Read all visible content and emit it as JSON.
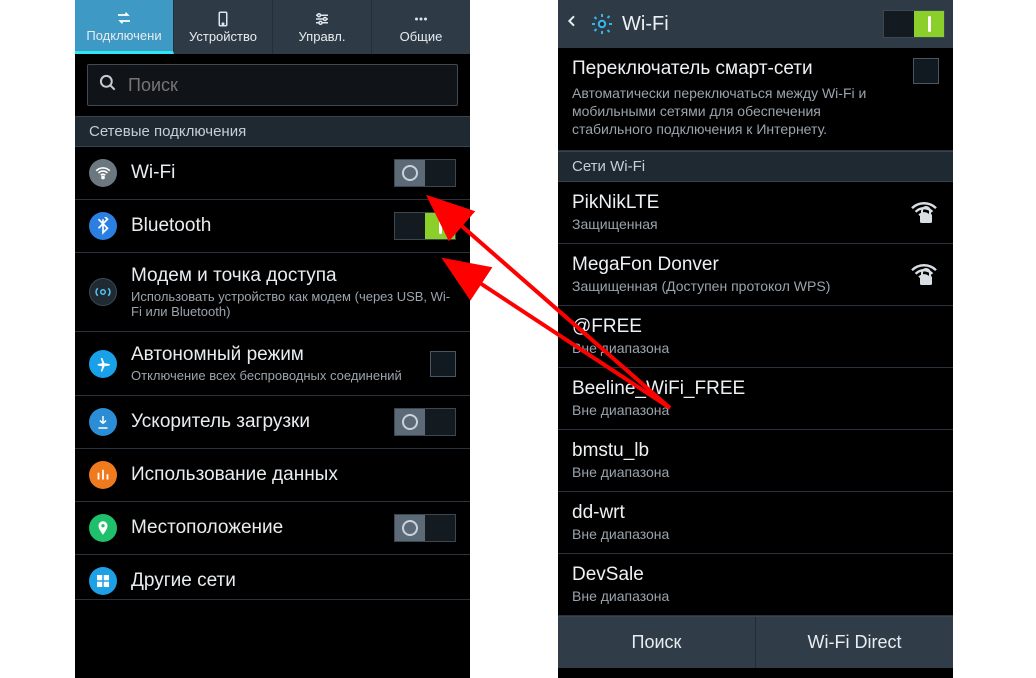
{
  "leftPhone": {
    "tabs": [
      {
        "label": "Подключени",
        "icon": "swap-icon",
        "active": true
      },
      {
        "label": "Устройство",
        "icon": "device-icon",
        "active": false
      },
      {
        "label": "Управл.",
        "icon": "sliders-icon",
        "active": false
      },
      {
        "label": "Общие",
        "icon": "more-icon",
        "active": false
      }
    ],
    "searchPlaceholder": "Поиск",
    "sectionHeader": "Сетевые подключения",
    "rows": {
      "wifi": {
        "title": "Wi-Fi"
      },
      "bluetooth": {
        "title": "Bluetooth"
      },
      "tethering": {
        "title": "Модем и точка доступа",
        "sub": "Использовать устройство как модем (через USB, Wi-Fi или Bluetooth)"
      },
      "airplane": {
        "title": "Автономный режим",
        "sub": "Отключение всех беспроводных соединений"
      },
      "booster": {
        "title": "Ускоритель загрузки"
      },
      "datausage": {
        "title": "Использование данных"
      },
      "location": {
        "title": "Местоположение"
      },
      "othernets": {
        "title": "Другие сети"
      }
    }
  },
  "rightPhone": {
    "title": "Wi-Fi",
    "smartNet": {
      "title": "Переключатель смарт-сети",
      "sub": "Автоматически переключаться между Wi-Fi и мобильными сетями для обеспечения стабильного подключения к Интернету."
    },
    "listHeader": "Сети Wi-Fi",
    "networks": [
      {
        "name": "PikNikLTE",
        "sub": "Защищенная",
        "signal": true,
        "locked": true
      },
      {
        "name": "MegaFon Donver",
        "sub": "Защищенная (Доступен протокол WPS)",
        "signal": true,
        "locked": true
      },
      {
        "name": "@FREE",
        "sub": "Вне диапазона",
        "signal": false,
        "locked": false
      },
      {
        "name": "Beeline_WiFi_FREE",
        "sub": "Вне диапазона",
        "signal": false,
        "locked": false
      },
      {
        "name": "bmstu_lb",
        "sub": "Вне диапазона",
        "signal": false,
        "locked": false
      },
      {
        "name": "dd-wrt",
        "sub": "Вне диапазона",
        "signal": false,
        "locked": false
      },
      {
        "name": "DevSale",
        "sub": "Вне диапазона",
        "signal": false,
        "locked": false
      }
    ],
    "footer": {
      "scan": "Поиск",
      "direct": "Wi-Fi Direct"
    }
  }
}
